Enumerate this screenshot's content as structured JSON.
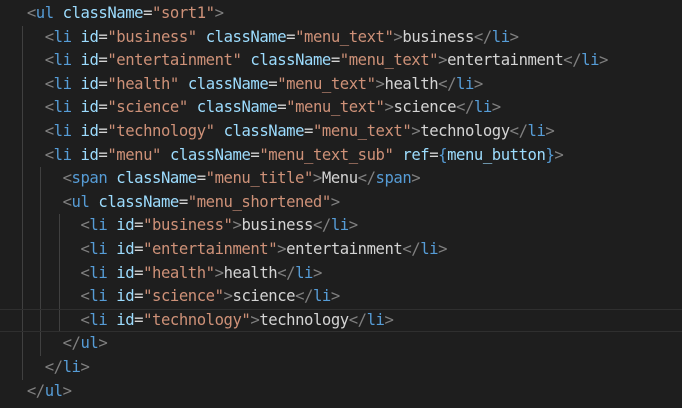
{
  "editor": {
    "indent_unit": "  ",
    "colors": {
      "background": "#1e1e1e",
      "punctuation": "#808080",
      "tag": "#569cd6",
      "attribute": "#9cdcfe",
      "operator": "#d4d4d4",
      "string": "#ce9178",
      "text": "#d4d4d4",
      "brace": "#569cd6",
      "indent_guide": "#404040"
    },
    "active_line_index": 13,
    "lines": [
      {
        "indent": 1,
        "tokens": [
          {
            "t": "<",
            "c": "punct"
          },
          {
            "t": "ul",
            "c": "tag"
          },
          {
            "t": " ",
            "c": "text"
          },
          {
            "t": "className",
            "c": "attr"
          },
          {
            "t": "=",
            "c": "op"
          },
          {
            "t": "\"sort1\"",
            "c": "str"
          },
          {
            "t": ">",
            "c": "punct"
          }
        ]
      },
      {
        "indent": 2,
        "tokens": [
          {
            "t": "<",
            "c": "punct"
          },
          {
            "t": "li",
            "c": "tag"
          },
          {
            "t": " ",
            "c": "text"
          },
          {
            "t": "id",
            "c": "attr"
          },
          {
            "t": "=",
            "c": "op"
          },
          {
            "t": "\"business\"",
            "c": "str"
          },
          {
            "t": " ",
            "c": "text"
          },
          {
            "t": "className",
            "c": "attr"
          },
          {
            "t": "=",
            "c": "op"
          },
          {
            "t": "\"menu_text\"",
            "c": "str"
          },
          {
            "t": ">",
            "c": "punct"
          },
          {
            "t": "business",
            "c": "text"
          },
          {
            "t": "</",
            "c": "punct"
          },
          {
            "t": "li",
            "c": "tag"
          },
          {
            "t": ">",
            "c": "punct"
          }
        ]
      },
      {
        "indent": 2,
        "tokens": [
          {
            "t": "<",
            "c": "punct"
          },
          {
            "t": "li",
            "c": "tag"
          },
          {
            "t": " ",
            "c": "text"
          },
          {
            "t": "id",
            "c": "attr"
          },
          {
            "t": "=",
            "c": "op"
          },
          {
            "t": "\"entertainment\"",
            "c": "str"
          },
          {
            "t": " ",
            "c": "text"
          },
          {
            "t": "className",
            "c": "attr"
          },
          {
            "t": "=",
            "c": "op"
          },
          {
            "t": "\"menu_text\"",
            "c": "str"
          },
          {
            "t": ">",
            "c": "punct"
          },
          {
            "t": "entertainment",
            "c": "text"
          },
          {
            "t": "</",
            "c": "punct"
          },
          {
            "t": "li",
            "c": "tag"
          },
          {
            "t": ">",
            "c": "punct"
          }
        ]
      },
      {
        "indent": 2,
        "tokens": [
          {
            "t": "<",
            "c": "punct"
          },
          {
            "t": "li",
            "c": "tag"
          },
          {
            "t": " ",
            "c": "text"
          },
          {
            "t": "id",
            "c": "attr"
          },
          {
            "t": "=",
            "c": "op"
          },
          {
            "t": "\"health\"",
            "c": "str"
          },
          {
            "t": " ",
            "c": "text"
          },
          {
            "t": "className",
            "c": "attr"
          },
          {
            "t": "=",
            "c": "op"
          },
          {
            "t": "\"menu_text\"",
            "c": "str"
          },
          {
            "t": ">",
            "c": "punct"
          },
          {
            "t": "health",
            "c": "text"
          },
          {
            "t": "</",
            "c": "punct"
          },
          {
            "t": "li",
            "c": "tag"
          },
          {
            "t": ">",
            "c": "punct"
          }
        ]
      },
      {
        "indent": 2,
        "tokens": [
          {
            "t": "<",
            "c": "punct"
          },
          {
            "t": "li",
            "c": "tag"
          },
          {
            "t": " ",
            "c": "text"
          },
          {
            "t": "id",
            "c": "attr"
          },
          {
            "t": "=",
            "c": "op"
          },
          {
            "t": "\"science\"",
            "c": "str"
          },
          {
            "t": " ",
            "c": "text"
          },
          {
            "t": "className",
            "c": "attr"
          },
          {
            "t": "=",
            "c": "op"
          },
          {
            "t": "\"menu_text\"",
            "c": "str"
          },
          {
            "t": ">",
            "c": "punct"
          },
          {
            "t": "science",
            "c": "text"
          },
          {
            "t": "</",
            "c": "punct"
          },
          {
            "t": "li",
            "c": "tag"
          },
          {
            "t": ">",
            "c": "punct"
          }
        ]
      },
      {
        "indent": 2,
        "tokens": [
          {
            "t": "<",
            "c": "punct"
          },
          {
            "t": "li",
            "c": "tag"
          },
          {
            "t": " ",
            "c": "text"
          },
          {
            "t": "id",
            "c": "attr"
          },
          {
            "t": "=",
            "c": "op"
          },
          {
            "t": "\"technology\"",
            "c": "str"
          },
          {
            "t": " ",
            "c": "text"
          },
          {
            "t": "className",
            "c": "attr"
          },
          {
            "t": "=",
            "c": "op"
          },
          {
            "t": "\"menu_text\"",
            "c": "str"
          },
          {
            "t": ">",
            "c": "punct"
          },
          {
            "t": "technology",
            "c": "text"
          },
          {
            "t": "</",
            "c": "punct"
          },
          {
            "t": "li",
            "c": "tag"
          },
          {
            "t": ">",
            "c": "punct"
          }
        ]
      },
      {
        "indent": 2,
        "tokens": [
          {
            "t": "<",
            "c": "punct"
          },
          {
            "t": "li",
            "c": "tag"
          },
          {
            "t": " ",
            "c": "text"
          },
          {
            "t": "id",
            "c": "attr"
          },
          {
            "t": "=",
            "c": "op"
          },
          {
            "t": "\"menu\"",
            "c": "str"
          },
          {
            "t": " ",
            "c": "text"
          },
          {
            "t": "className",
            "c": "attr"
          },
          {
            "t": "=",
            "c": "op"
          },
          {
            "t": "\"menu_text_sub\"",
            "c": "str"
          },
          {
            "t": " ",
            "c": "text"
          },
          {
            "t": "ref",
            "c": "attr"
          },
          {
            "t": "=",
            "c": "op"
          },
          {
            "t": "{",
            "c": "brace"
          },
          {
            "t": "menu_button",
            "c": "attr"
          },
          {
            "t": "}",
            "c": "brace"
          },
          {
            "t": ">",
            "c": "punct"
          }
        ]
      },
      {
        "indent": 3,
        "tokens": [
          {
            "t": "<",
            "c": "punct"
          },
          {
            "t": "span",
            "c": "tag"
          },
          {
            "t": " ",
            "c": "text"
          },
          {
            "t": "className",
            "c": "attr"
          },
          {
            "t": "=",
            "c": "op"
          },
          {
            "t": "\"menu_title\"",
            "c": "str"
          },
          {
            "t": ">",
            "c": "punct"
          },
          {
            "t": "Menu",
            "c": "text"
          },
          {
            "t": "</",
            "c": "punct"
          },
          {
            "t": "span",
            "c": "tag"
          },
          {
            "t": ">",
            "c": "punct"
          }
        ]
      },
      {
        "indent": 3,
        "tokens": [
          {
            "t": "<",
            "c": "punct"
          },
          {
            "t": "ul",
            "c": "tag"
          },
          {
            "t": " ",
            "c": "text"
          },
          {
            "t": "className",
            "c": "attr"
          },
          {
            "t": "=",
            "c": "op"
          },
          {
            "t": "\"menu_shortened\"",
            "c": "str"
          },
          {
            "t": ">",
            "c": "punct"
          }
        ]
      },
      {
        "indent": 4,
        "tokens": [
          {
            "t": "<",
            "c": "punct"
          },
          {
            "t": "li",
            "c": "tag"
          },
          {
            "t": " ",
            "c": "text"
          },
          {
            "t": "id",
            "c": "attr"
          },
          {
            "t": "=",
            "c": "op"
          },
          {
            "t": "\"business\"",
            "c": "str"
          },
          {
            "t": ">",
            "c": "punct"
          },
          {
            "t": "business",
            "c": "text"
          },
          {
            "t": "</",
            "c": "punct"
          },
          {
            "t": "li",
            "c": "tag"
          },
          {
            "t": ">",
            "c": "punct"
          }
        ]
      },
      {
        "indent": 4,
        "tokens": [
          {
            "t": "<",
            "c": "punct"
          },
          {
            "t": "li",
            "c": "tag"
          },
          {
            "t": " ",
            "c": "text"
          },
          {
            "t": "id",
            "c": "attr"
          },
          {
            "t": "=",
            "c": "op"
          },
          {
            "t": "\"entertainment\"",
            "c": "str"
          },
          {
            "t": ">",
            "c": "punct"
          },
          {
            "t": "entertainment",
            "c": "text"
          },
          {
            "t": "</",
            "c": "punct"
          },
          {
            "t": "li",
            "c": "tag"
          },
          {
            "t": ">",
            "c": "punct"
          }
        ]
      },
      {
        "indent": 4,
        "tokens": [
          {
            "t": "<",
            "c": "punct"
          },
          {
            "t": "li",
            "c": "tag"
          },
          {
            "t": " ",
            "c": "text"
          },
          {
            "t": "id",
            "c": "attr"
          },
          {
            "t": "=",
            "c": "op"
          },
          {
            "t": "\"health\"",
            "c": "str"
          },
          {
            "t": ">",
            "c": "punct"
          },
          {
            "t": "health",
            "c": "text"
          },
          {
            "t": "</",
            "c": "punct"
          },
          {
            "t": "li",
            "c": "tag"
          },
          {
            "t": ">",
            "c": "punct"
          }
        ]
      },
      {
        "indent": 4,
        "tokens": [
          {
            "t": "<",
            "c": "punct"
          },
          {
            "t": "li",
            "c": "tag"
          },
          {
            "t": " ",
            "c": "text"
          },
          {
            "t": "id",
            "c": "attr"
          },
          {
            "t": "=",
            "c": "op"
          },
          {
            "t": "\"science\"",
            "c": "str"
          },
          {
            "t": ">",
            "c": "punct"
          },
          {
            "t": "science",
            "c": "text"
          },
          {
            "t": "</",
            "c": "punct"
          },
          {
            "t": "li",
            "c": "tag"
          },
          {
            "t": ">",
            "c": "punct"
          }
        ]
      },
      {
        "indent": 4,
        "tokens": [
          {
            "t": "<",
            "c": "punct"
          },
          {
            "t": "li",
            "c": "tag"
          },
          {
            "t": " ",
            "c": "text"
          },
          {
            "t": "id",
            "c": "attr"
          },
          {
            "t": "=",
            "c": "op"
          },
          {
            "t": "\"technology\"",
            "c": "str"
          },
          {
            "t": ">",
            "c": "punct"
          },
          {
            "t": "technology",
            "c": "text"
          },
          {
            "t": "</",
            "c": "punct"
          },
          {
            "t": "li",
            "c": "tag"
          },
          {
            "t": ">",
            "c": "punct"
          }
        ]
      },
      {
        "indent": 3,
        "tokens": [
          {
            "t": "</",
            "c": "punct"
          },
          {
            "t": "ul",
            "c": "tag"
          },
          {
            "t": ">",
            "c": "punct"
          }
        ]
      },
      {
        "indent": 2,
        "tokens": [
          {
            "t": "</",
            "c": "punct"
          },
          {
            "t": "li",
            "c": "tag"
          },
          {
            "t": ">",
            "c": "punct"
          }
        ]
      },
      {
        "indent": 1,
        "tokens": [
          {
            "t": "</",
            "c": "punct"
          },
          {
            "t": "ul",
            "c": "tag"
          },
          {
            "t": ">",
            "c": "punct"
          }
        ]
      }
    ]
  }
}
